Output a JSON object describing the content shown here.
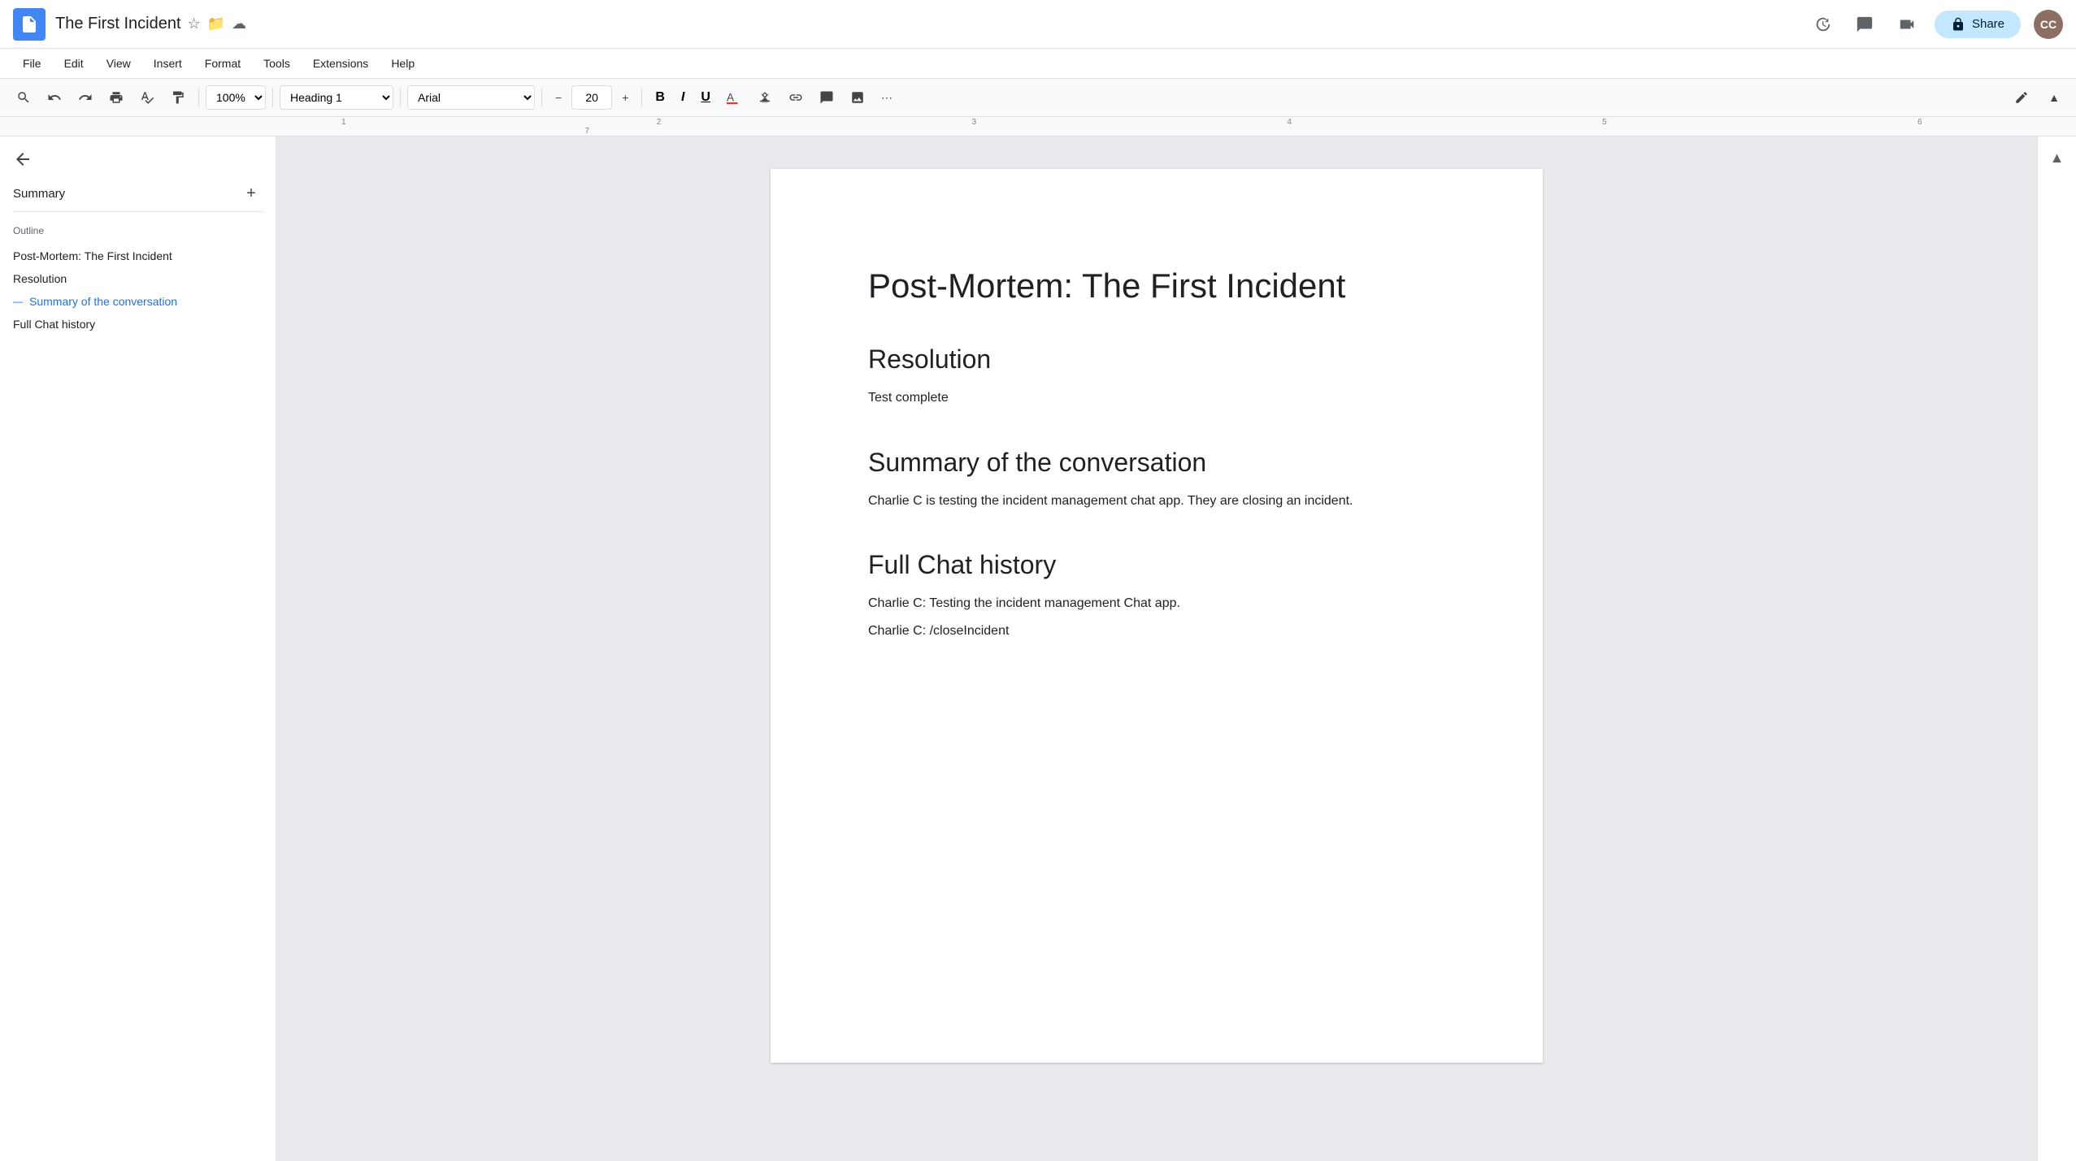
{
  "titleBar": {
    "docTitle": "The First Incident",
    "shareLabel": "Share",
    "starIcon": "☆",
    "folderIcon": "📁",
    "cloudIcon": "☁"
  },
  "menuBar": {
    "items": [
      "File",
      "Edit",
      "View",
      "Insert",
      "Format",
      "Tools",
      "Extensions",
      "Help"
    ]
  },
  "toolbar": {
    "zoom": "100%",
    "style": "Heading 1",
    "font": "Arial",
    "fontSize": "20",
    "boldLabel": "B",
    "italicLabel": "I",
    "underlineLabel": "U"
  },
  "sidebar": {
    "summaryLabel": "Summary",
    "outlineLabel": "Outline",
    "outlineItems": [
      {
        "label": "Post-Mortem: The First Incident",
        "active": false
      },
      {
        "label": "Resolution",
        "active": false
      },
      {
        "label": "Summary of the conversation",
        "active": true
      },
      {
        "label": "Full Chat history",
        "active": false
      }
    ]
  },
  "document": {
    "title": "Post-Mortem: The First Incident",
    "sections": [
      {
        "heading": "Resolution",
        "body": "Test complete"
      },
      {
        "heading": "Summary of the conversation",
        "body": "Charlie C is testing the incident management chat app. They are closing an incident."
      },
      {
        "heading": "Full Chat history",
        "lines": [
          "Charlie C: Testing the incident management Chat app.",
          "Charlie C: /closeIncident"
        ]
      }
    ]
  }
}
